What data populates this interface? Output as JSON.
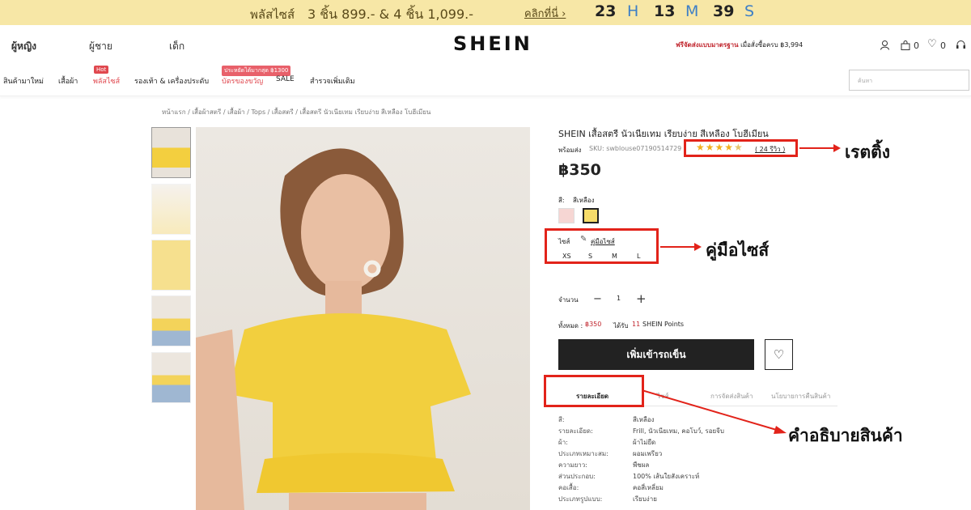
{
  "promo": {
    "label": "พลัสไซส์",
    "deal": "3 ชิ้น 899.- & 4 ชิ้น 1,099.-",
    "click": "คลิกที่นี่ ›",
    "h": "23",
    "hl": "H",
    "m": "13",
    "ml": "M",
    "s": "39",
    "sl": "S"
  },
  "header": {
    "nav": [
      "ผู้หญิง",
      "ผู้ชาย",
      "เด็ก"
    ],
    "logo": "SHEIN",
    "ship_bold": "ฟรีจัดส่งแบบมาตรฐาน",
    "ship_rest": " เมื่อสั่งซื้อครบ ฿3,994",
    "bag_count": "0",
    "wish_count": "0"
  },
  "cats": {
    "items": [
      "สินค้ามาใหม่",
      "เสื้อผ้า",
      "พลัสไซส์",
      "รองเท้า & เครื่องประดับ",
      "บัตรของขวัญ",
      "SALE",
      "สำรวจเพิ่มเติม"
    ],
    "hot": "Hot",
    "promo_badge": "ประหยัดได้มากสุด ฿1300",
    "search_placeholder": "ค้นหา"
  },
  "breadcrumb": "หน้าแรก / เสื้อผ้าสตรี / เสื้อผ้า / Tops / เสื้อสตรี / เสื้อสตรี นัวเนียเทม เรียบง่าย สีเหลือง โบฮีเมียน",
  "product": {
    "title": "SHEIN เสื้อสตรี นัวเนียเทม เรียบง่าย สีเหลือง โบฮีเมียน",
    "stock": "พร้อมส่ง",
    "sku": "SKU: swblouse07190514729",
    "rating": 4.5,
    "reviews": "( 24 รีวิว )",
    "price": "฿350",
    "color_label": "สี:",
    "color_value": "สีเหลือง",
    "colors": [
      "#f6d6d3",
      "#f6dc6a"
    ],
    "size_label": "ไซส์",
    "size_guide": "คู่มือไซส์",
    "sizes": [
      "XS",
      "S",
      "M",
      "L"
    ],
    "qty_label": "จำนวน",
    "qty": "1",
    "total_label": "ทั้งหมด :",
    "total": "฿350",
    "points_pre": "ได้รับ",
    "points": "11",
    "points_post": "SHEIN Points",
    "add_cart": "เพิ่มเข้ารถเข็น"
  },
  "tabs": [
    "รายละเอียด",
    "ไซส์",
    "การจัดส่งสินค้า",
    "นโยบายการคืนสินค้า"
  ],
  "details": [
    [
      "สี:",
      "สีเหลือง"
    ],
    [
      "รายละเอียด:",
      "Frill, นัวเนียเทม, คอโบว์, รอยจีบ"
    ],
    [
      "ผ้า:",
      "ผ้าไม่ยืด"
    ],
    [
      "ประเภทเหมาะสม:",
      "ผอมเพรียว"
    ],
    [
      "ความยาว:",
      "พืชผล"
    ],
    [
      "ส่วนประกอบ:",
      "100% เส้นใยสังเคราะห์"
    ],
    [
      "คอเสื้อ:",
      "คอสี่เหลี่ยม"
    ],
    [
      "ประเภทรูปแบบ:",
      "เรียบง่าย"
    ]
  ],
  "annotations": {
    "rating": "เรตติ้ง",
    "size_guide": "คู่มือไซส์",
    "description": "คำอธิบายสินค้า",
    "accent": "#e2231a"
  }
}
